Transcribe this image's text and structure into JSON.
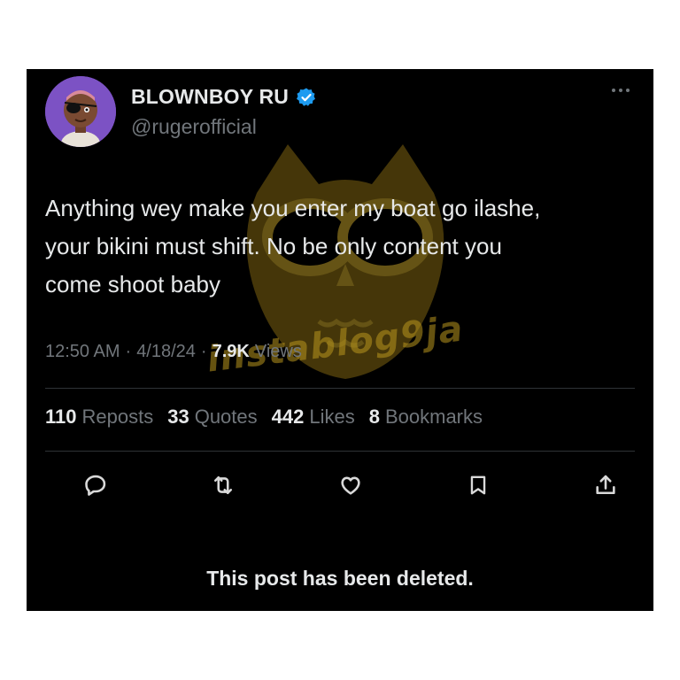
{
  "post": {
    "author": {
      "display_name": "BLOWNBOY RU",
      "handle": "@rugerofficial",
      "verified": true,
      "avatar_icon": "cartoon-avatar-icon"
    },
    "text_lines": [
      "Anything wey make you enter my boat go ilashe,",
      "your bikini must shift. No be only content you",
      "come shoot baby"
    ],
    "time": "12:50 AM",
    "date": "4/18/24",
    "views_count": "7.9K",
    "views_label": "Views",
    "stats": [
      {
        "count": "110",
        "label": "Reposts"
      },
      {
        "count": "33",
        "label": "Quotes"
      },
      {
        "count": "442",
        "label": "Likes"
      },
      {
        "count": "8",
        "label": "Bookmarks"
      }
    ],
    "actions": [
      "reply-icon",
      "repost-icon",
      "like-icon",
      "bookmark-icon",
      "share-icon"
    ],
    "deleted_notice": "This post has been deleted."
  },
  "watermark": {
    "text": "instablog9ja",
    "color": "#b8951e"
  },
  "colors": {
    "background": "#000000",
    "text_primary": "#e7e9ea",
    "text_secondary": "#71767b",
    "verified_blue": "#1d9bf0",
    "divider": "#2f3336"
  }
}
